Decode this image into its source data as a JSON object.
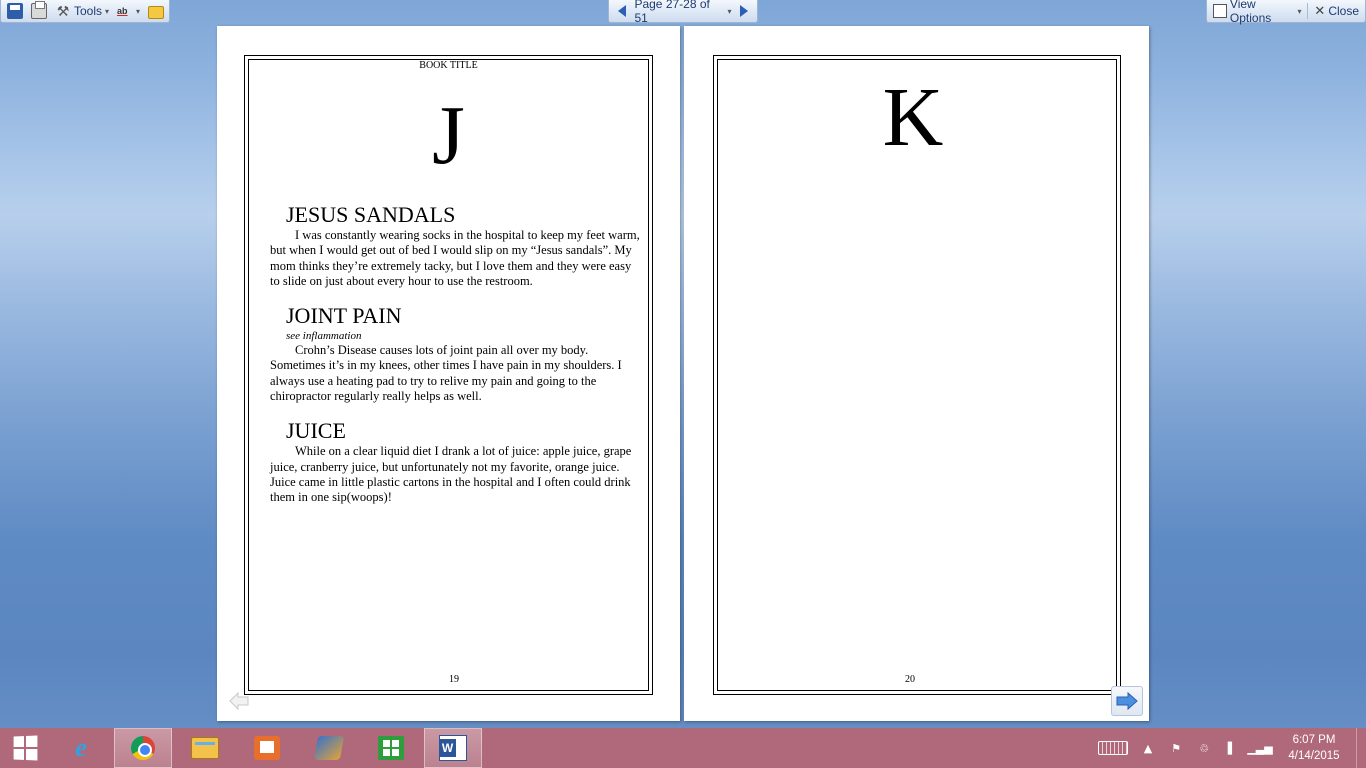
{
  "toolbar": {
    "tools_label": "Tools",
    "page_indicator": "Page 27-28 of 51",
    "view_options_label": "View Options",
    "close_label": "Close"
  },
  "left_page": {
    "header": "BOOK TITLE",
    "letter": "J",
    "entries": [
      {
        "title": "JESUS SANDALS",
        "body": "I was constantly wearing socks in the hospital to keep my feet warm, but when I would get out of bed I would slip on my “Jesus sandals”. My mom thinks they’re extremely tacky, but I love them and they were easy to slide on just about every hour to use the restroom."
      },
      {
        "title": "JOINT PAIN",
        "see": "see inflammation",
        "body": "Crohn’s Disease causes lots of joint pain all over my body. Sometimes it’s in my knees, other times I have pain in my shoulders. I always use a heating pad to try to relive my pain and going to the chiropractor regularly really helps as well."
      },
      {
        "title": "JUICE",
        "body": "While on a clear liquid diet I drank a lot of juice: apple juice, grape juice, cranberry juice, but unfortunately not my favorite, orange juice. Juice came in little plastic cartons in the hospital and I often could drink them in one sip(woops)!"
      }
    ],
    "page_number": "19"
  },
  "right_page": {
    "letter": "K",
    "page_number": "20"
  },
  "taskbar": {
    "time": "6:07 PM",
    "date": "4/14/2015"
  },
  "colors": {
    "taskbar": "#b0697a",
    "toolbar_text": "#1e3b70",
    "nav_arrow": "#2a5fb5"
  }
}
